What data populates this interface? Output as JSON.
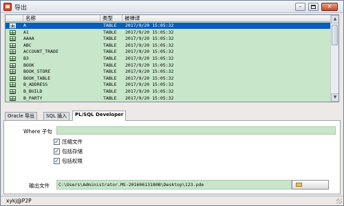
{
  "window": {
    "title": "导出"
  },
  "grid": {
    "columns": [
      "名称",
      "类型",
      "被禅译"
    ],
    "rows": [
      {
        "name": "A",
        "type": "TABLE",
        "date": "2017/9/20 15:05:32",
        "selected": true
      },
      {
        "name": "A1",
        "type": "TABLE",
        "date": "2017/9/20 15:05:32"
      },
      {
        "name": "AAAA",
        "type": "TABLE",
        "date": "2017/9/20 15:05:32"
      },
      {
        "name": "ABC",
        "type": "TABLE",
        "date": "2017/9/20 15:05:32"
      },
      {
        "name": "ACCOUNT_TRADE",
        "type": "TABLE",
        "date": "2017/9/20 15:05:32"
      },
      {
        "name": "B3",
        "type": "TABLE",
        "date": "2017/9/20 15:05:32"
      },
      {
        "name": "BOOK",
        "type": "TABLE",
        "date": "2017/9/20 15:05:32"
      },
      {
        "name": "BOOK_STORE",
        "type": "TABLE",
        "date": "2017/9/20 15:05:32"
      },
      {
        "name": "BOOK_TABLE",
        "type": "TABLE",
        "date": "2017/9/20 15:05:32"
      },
      {
        "name": "B_ADDRESS",
        "type": "TABLE",
        "date": "2017/9/20 15:05:32"
      },
      {
        "name": "B_BUILD",
        "type": "TABLE",
        "date": "2017/9/20 15:05:32"
      },
      {
        "name": "B_PARTY",
        "type": "TABLE",
        "date": "2017/9/20 15:05:32"
      }
    ]
  },
  "tabs": [
    {
      "label": "Oracle 导出",
      "active": false
    },
    {
      "label": "SQL 插入",
      "active": false
    },
    {
      "label": "PL/SQL Developer",
      "active": true
    }
  ],
  "panel": {
    "where_label": "Where 子句",
    "where_value": "",
    "options": [
      {
        "label": "压缩文件",
        "checked": true
      },
      {
        "label": "包括存储",
        "checked": true
      },
      {
        "label": "包括权限",
        "checked": true
      }
    ],
    "output_label": "输出文件",
    "output_value": "C:\\Users\\Administrator.MS-20160613180B\\Desktop\\123.pde"
  },
  "status": {
    "text": "xykj@P2P"
  },
  "colors": {
    "selected_row": "#0a5cbf",
    "row_bg": "#c8e6c9",
    "field_bg": "#c8e6c9"
  }
}
